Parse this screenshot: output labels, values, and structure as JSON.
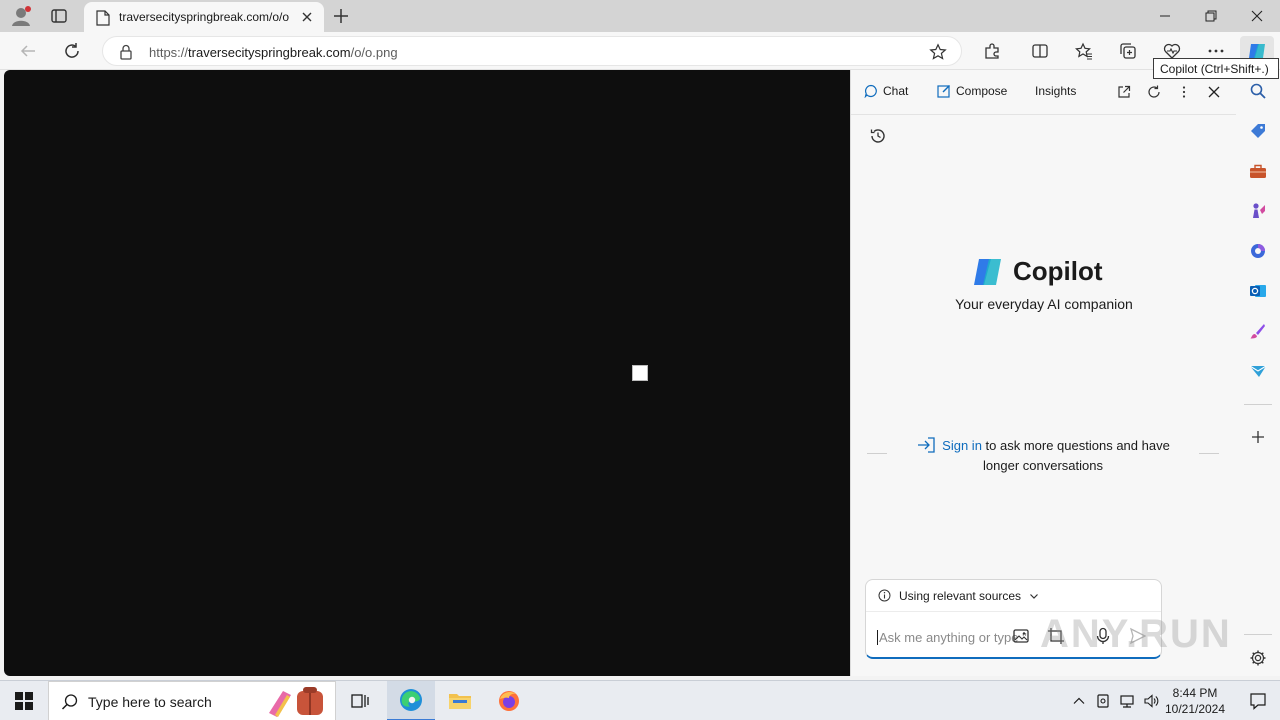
{
  "browser": {
    "tab": {
      "title": "traversecityspringbreak.com/o/o"
    },
    "address": {
      "prefix": "https://",
      "host": "traversecityspringbreak.com",
      "path": "/o/o.png"
    },
    "tooltip": "Copilot (Ctrl+Shift+.)"
  },
  "copilot": {
    "tabs": {
      "chat": "Chat",
      "compose": "Compose",
      "insights": "Insights"
    },
    "brand_name": "Copilot",
    "tagline": "Your everyday AI companion",
    "signin_link": "Sign in",
    "signin_text": " to ask more questions and have longer conversations",
    "sources_label": "Using relevant sources",
    "input_placeholder": "Ask me anything or type \"@\" to",
    "accent_color": "#0f6cbd"
  },
  "watermark": "ANY.RUN",
  "taskbar": {
    "search_placeholder": "Type here to search",
    "time": "8:44 PM",
    "date": "10/21/2024"
  }
}
